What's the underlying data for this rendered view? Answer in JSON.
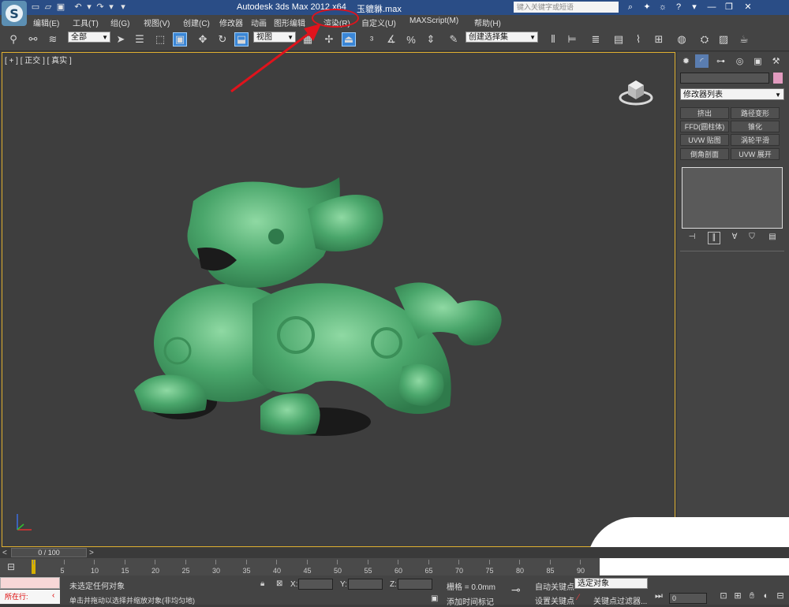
{
  "titlebar": {
    "logo": "3ds-max-logo",
    "title": "Autodesk 3ds Max  2012 x64",
    "file": "玉貔貅.max",
    "search_placeholder": "键入关键字或短语",
    "icons": [
      "binoculars-icon",
      "star-icon",
      "community-icon",
      "help-icon"
    ]
  },
  "menubar": {
    "items": [
      "编辑(E)",
      "工具(T)",
      "组(G)",
      "视图(V)",
      "创建(C)",
      "修改器",
      "动画",
      "图形编辑",
      "渲染(R)",
      "自定义(U)",
      "MAXScript(M)",
      "帮助(H)"
    ]
  },
  "toolbar": {
    "selection_filter": "全部",
    "reference_coord": "视图",
    "named_selection": "创建选择集"
  },
  "viewport": {
    "label": "[ + ] [ 正交 ] [ 真实 ]",
    "object": "jade-pixiu-statue",
    "object_color": "#4aa66b"
  },
  "cmdpanel": {
    "modifier_list": "修改器列表",
    "modifier_buttons": [
      "挤出",
      "路径变形",
      "FFD(圆柱体)",
      "锥化",
      "UVW 贴图",
      "涡轮平滑",
      "倒角剖面",
      "UVW 展开"
    ],
    "object_color": "#e29bbf"
  },
  "timeline": {
    "frame_counter": "0 / 100",
    "ticks": [
      "5",
      "10",
      "15",
      "20",
      "25",
      "30",
      "35",
      "40",
      "45",
      "50",
      "55",
      "60",
      "65",
      "70",
      "75",
      "80",
      "85",
      "90"
    ]
  },
  "statusbar": {
    "running_label": "所在行:",
    "selection_status": "未选定任何对象",
    "prompt": "单击并拖动以选择并缩放对象(非均匀地)",
    "x_label": "X:",
    "y_label": "Y:",
    "z_label": "Z:",
    "grid": "栅格 = 0.0mm",
    "add_time_tag": "添加时间标记",
    "auto_key": "自动关键点",
    "set_key": "设置关键点",
    "selected_drop": "选定对象",
    "key_filters": "关键点过滤器...",
    "frame_value": "0"
  },
  "annotation": {
    "color": "#e0131c"
  }
}
